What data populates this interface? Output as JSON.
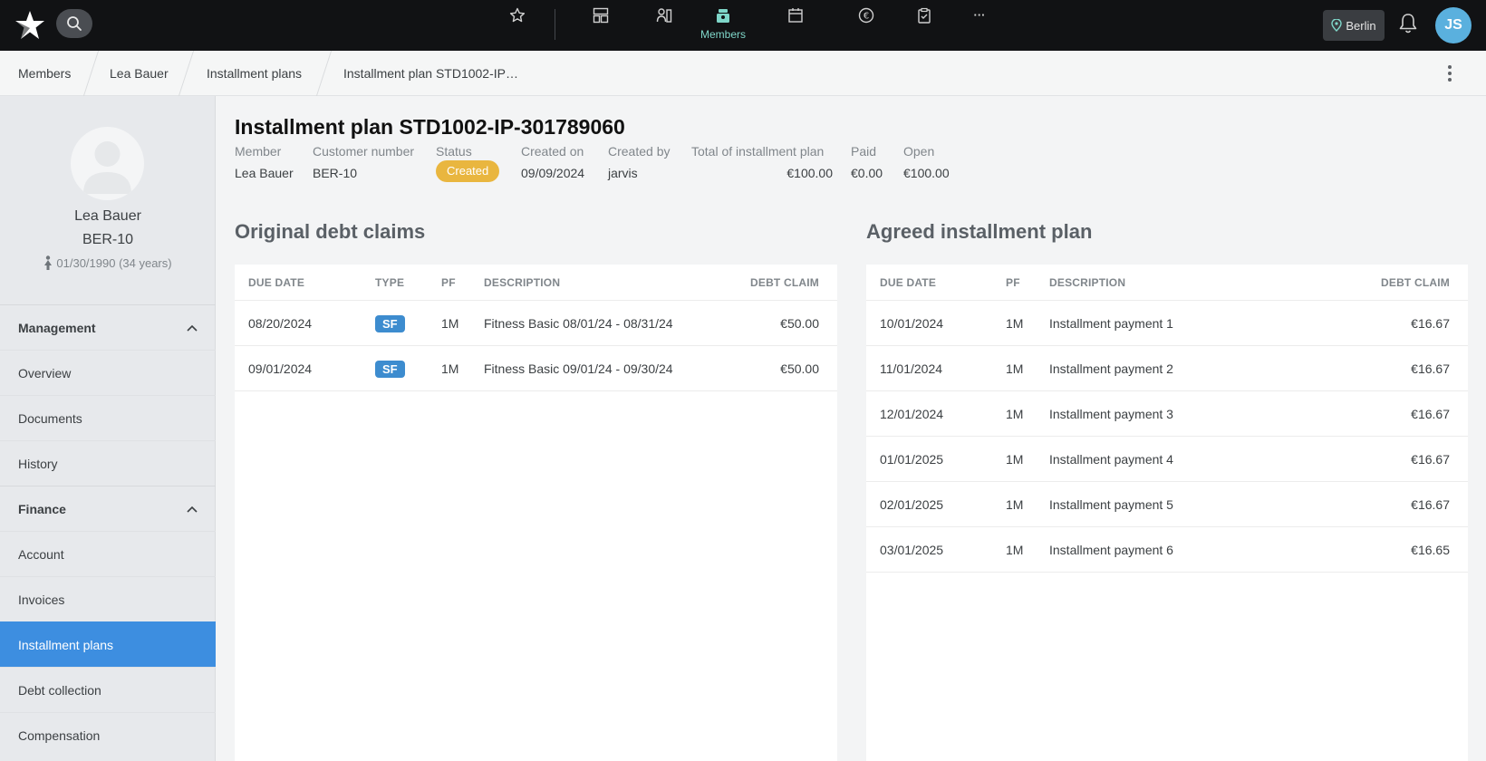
{
  "topnav": {
    "items": [
      {
        "icon": "star-icon",
        "label": ""
      },
      {
        "icon": "dashboard-icon",
        "label": ""
      },
      {
        "icon": "contacts-icon",
        "label": ""
      },
      {
        "icon": "members-icon",
        "label": "Members"
      },
      {
        "icon": "calendar-icon",
        "label": ""
      },
      {
        "icon": "euro-icon",
        "label": ""
      },
      {
        "icon": "clipboard-icon",
        "label": ""
      },
      {
        "icon": "more-icon",
        "label": "···"
      }
    ],
    "active_label": "Members",
    "location": "Berlin",
    "user_initials": "JS",
    "accent_color": "#7fd6c9"
  },
  "breadcrumb": [
    "Members",
    "Lea Bauer",
    "Installment plans",
    "Installment plan STD1002-IP…"
  ],
  "profile": {
    "name": "Lea Bauer",
    "customer_number": "BER-10",
    "dob": "01/30/1990 (34 years)"
  },
  "sidebar": {
    "management_title": "Management",
    "management_items": [
      "Overview",
      "Documents",
      "History"
    ],
    "finance_title": "Finance",
    "finance_items": [
      "Account",
      "Invoices",
      "Installment plans",
      "Debt collection",
      "Compensation"
    ],
    "active_item": "Installment plans",
    "active_color": "#3d8ee0"
  },
  "plan": {
    "title": "Installment plan STD1002-IP-301789060",
    "labels": {
      "member": "Member",
      "customer_number": "Customer number",
      "status": "Status",
      "created_on": "Created on",
      "created_by": "Created by",
      "total": "Total of installment plan",
      "paid": "Paid",
      "open": "Open"
    },
    "values": {
      "member": "Lea Bauer",
      "customer_number": "BER-10",
      "status": "Created",
      "created_on": "09/09/2024",
      "created_by": "jarvis",
      "total": "€100.00",
      "paid": "€0.00",
      "open": "€100.00"
    },
    "status_color": "#e9b63f"
  },
  "original_claims": {
    "title": "Original debt claims",
    "columns": [
      "DUE DATE",
      "TYPE",
      "PF",
      "DESCRIPTION",
      "DEBT CLAIM"
    ],
    "rows": [
      {
        "due": "08/20/2024",
        "type": "SF",
        "pf": "1M",
        "desc": "Fitness Basic 08/01/24 - 08/31/24",
        "amount": "€50.00"
      },
      {
        "due": "09/01/2024",
        "type": "SF",
        "pf": "1M",
        "desc": "Fitness Basic 09/01/24 - 09/30/24",
        "amount": "€50.00"
      }
    ]
  },
  "agreed_plan": {
    "title": "Agreed installment plan",
    "columns": [
      "DUE DATE",
      "PF",
      "DESCRIPTION",
      "DEBT CLAIM"
    ],
    "rows": [
      {
        "due": "10/01/2024",
        "pf": "1M",
        "desc": "Installment payment 1",
        "amount": "€16.67"
      },
      {
        "due": "11/01/2024",
        "pf": "1M",
        "desc": "Installment payment 2",
        "amount": "€16.67"
      },
      {
        "due": "12/01/2024",
        "pf": "1M",
        "desc": "Installment payment 3",
        "amount": "€16.67"
      },
      {
        "due": "01/01/2025",
        "pf": "1M",
        "desc": "Installment payment 4",
        "amount": "€16.67"
      },
      {
        "due": "02/01/2025",
        "pf": "1M",
        "desc": "Installment payment 5",
        "amount": "€16.67"
      },
      {
        "due": "03/01/2025",
        "pf": "1M",
        "desc": "Installment payment 6",
        "amount": "€16.65"
      }
    ]
  }
}
